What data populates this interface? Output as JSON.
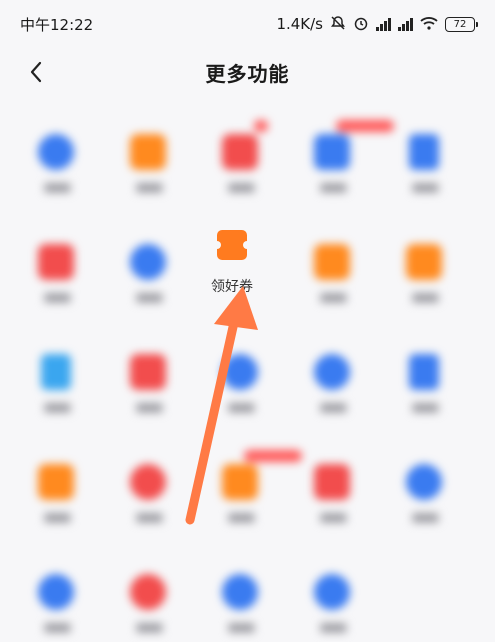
{
  "status_bar": {
    "time": "中午12:22",
    "network_speed": "1.4K/s",
    "battery_level": "72"
  },
  "header": {
    "title": "更多功能"
  },
  "featured_item": {
    "label": "领好券",
    "icon": "coupon-icon",
    "color": "#ff7b1f"
  },
  "grid_items": [
    {
      "icon": "circle",
      "color": "#3a7bf0",
      "label": "",
      "badge": ""
    },
    {
      "icon": "umbrella",
      "color": "#ff8a1f",
      "label": "",
      "badge": ""
    },
    {
      "icon": "gift-box",
      "color": "#f24d4d",
      "label": "",
      "badge": "dot"
    },
    {
      "icon": "card",
      "color": "#3a7bf0",
      "label": "",
      "badge": "wide"
    },
    {
      "icon": "doc",
      "color": "#3a7bf0",
      "label": "",
      "badge": ""
    },
    {
      "icon": "piggy",
      "color": "#f24d4d",
      "label": "",
      "badge": ""
    },
    {
      "icon": "play",
      "color": "#3a7bf0",
      "label": "",
      "badge": ""
    },
    {
      "icon": "featured",
      "color": "#ff7b1f",
      "label": "",
      "badge": ""
    },
    {
      "icon": "stamp",
      "color": "#ff8a1f",
      "label": "",
      "badge": ""
    },
    {
      "icon": "square",
      "color": "#ff8a1f",
      "label": "",
      "badge": ""
    },
    {
      "icon": "doc",
      "color": "#3aa6ef",
      "label": "",
      "badge": ""
    },
    {
      "icon": "basket",
      "color": "#f24d4d",
      "label": "",
      "badge": ""
    },
    {
      "icon": "play",
      "color": "#3a7bf0",
      "label": "",
      "badge": ""
    },
    {
      "icon": "p-circle",
      "color": "#3a7bf0",
      "label": "",
      "badge": ""
    },
    {
      "icon": "doc",
      "color": "#3a7bf0",
      "label": "",
      "badge": ""
    },
    {
      "icon": "wallet",
      "color": "#ff8a1f",
      "label": "",
      "badge": ""
    },
    {
      "icon": "circle",
      "color": "#f24d4d",
      "label": "",
      "badge": ""
    },
    {
      "icon": "bag",
      "color": "#ff8a1f",
      "label": "",
      "badge": "wide"
    },
    {
      "icon": "gift",
      "color": "#f24d4d",
      "label": "",
      "badge": ""
    },
    {
      "icon": "drop",
      "color": "#3a7bf0",
      "label": "",
      "badge": ""
    },
    {
      "icon": "circle",
      "color": "#3a7bf0",
      "label": "",
      "badge": ""
    },
    {
      "icon": "circle",
      "color": "#f24d4d",
      "label": "",
      "badge": ""
    },
    {
      "icon": "cloud",
      "color": "#3a7bf0",
      "label": "",
      "badge": ""
    },
    {
      "icon": "info",
      "color": "#3a7bf0",
      "label": "",
      "badge": ""
    }
  ],
  "annotation": {
    "arrow_color": "#ff7a45"
  }
}
